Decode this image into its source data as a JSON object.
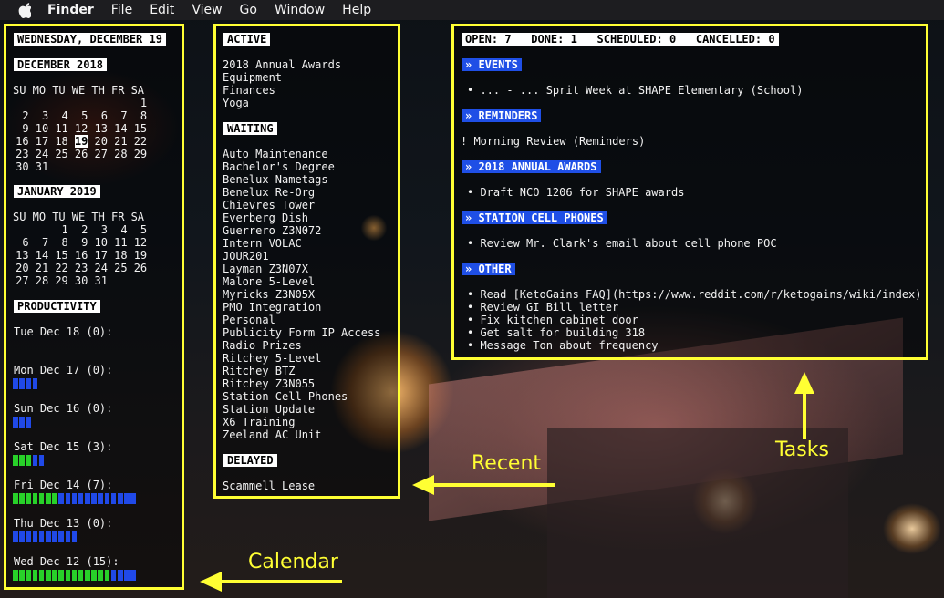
{
  "menubar": {
    "app": "Finder",
    "items": [
      "File",
      "Edit",
      "View",
      "Go",
      "Window",
      "Help"
    ]
  },
  "calendar": {
    "date_heading": "WEDNESDAY, DECEMBER 19",
    "months": [
      {
        "heading": "DECEMBER 2018",
        "weekdays": [
          "SU",
          "MO",
          "TU",
          "WE",
          "TH",
          "FR",
          "SA"
        ],
        "weeks": [
          [
            "",
            "",
            "",
            "",
            "",
            "",
            "1"
          ],
          [
            "2",
            "3",
            "4",
            "5",
            "6",
            "7",
            "8"
          ],
          [
            "9",
            "10",
            "11",
            "12",
            "13",
            "14",
            "15"
          ],
          [
            "16",
            "17",
            "18",
            "19",
            "20",
            "21",
            "22"
          ],
          [
            "23",
            "24",
            "25",
            "26",
            "27",
            "28",
            "29"
          ],
          [
            "30",
            "31",
            "",
            "",
            "",
            "",
            ""
          ]
        ],
        "today": "19"
      },
      {
        "heading": "JANUARY 2019",
        "weekdays": [
          "SU",
          "MO",
          "TU",
          "WE",
          "TH",
          "FR",
          "SA"
        ],
        "weeks": [
          [
            "",
            "",
            "1",
            "2",
            "3",
            "4",
            "5"
          ],
          [
            "6",
            "7",
            "8",
            "9",
            "10",
            "11",
            "12"
          ],
          [
            "13",
            "14",
            "15",
            "16",
            "17",
            "18",
            "19"
          ],
          [
            "20",
            "21",
            "22",
            "23",
            "24",
            "25",
            "26"
          ],
          [
            "27",
            "28",
            "29",
            "30",
            "31",
            "",
            ""
          ]
        ],
        "today": ""
      }
    ],
    "productivity": {
      "heading": "PRODUCTIVITY",
      "days": [
        {
          "label": "Tue Dec 18 (0):",
          "done": 0,
          "pending": 0
        },
        {
          "label": "Mon Dec 17 (0):",
          "done": 0,
          "pending": 4
        },
        {
          "label": "Sun Dec 16 (0):",
          "done": 0,
          "pending": 3
        },
        {
          "label": "Sat Dec 15 (3):",
          "done": 3,
          "pending": 2
        },
        {
          "label": "Fri Dec 14 (7):",
          "done": 7,
          "pending": 12
        },
        {
          "label": "Thu Dec 13 (0):",
          "done": 0,
          "pending": 10
        },
        {
          "label": "Wed Dec 12 (15):",
          "done": 15,
          "pending": 4
        }
      ]
    }
  },
  "recent": {
    "sections": [
      {
        "heading": "ACTIVE",
        "items": [
          "2018 Annual Awards",
          "Equipment",
          "Finances",
          "Yoga"
        ]
      },
      {
        "heading": "WAITING",
        "items": [
          "Auto Maintenance",
          "Bachelor's Degree",
          "Benelux Nametags",
          "Benelux Re-Org",
          "Chievres Tower",
          "Everberg Dish",
          "Guerrero Z3N072",
          "Intern VOLAC",
          "JOUR201",
          "Layman Z3N07X",
          "Malone 5-Level",
          "Myricks Z3N05X",
          "PMO Integration",
          "Personal",
          "Publicity Form IP Access",
          "Radio Prizes",
          "Ritchey 5-Level",
          "Ritchey BTZ",
          "Ritchey Z3N055",
          "Station Cell Phones",
          "Station Update",
          "X6 Training",
          "Zeeland AC Unit"
        ]
      },
      {
        "heading": "DELAYED",
        "items": [
          "Scammell Lease"
        ]
      }
    ]
  },
  "tasks": {
    "status": "OPEN: 7   DONE: 1   SCHEDULED: 0   CANCELLED: 0",
    "sections": [
      {
        "heading": "» EVENTS",
        "items": [
          "• ... - ... Sprit Week at SHAPE Elementary (School)"
        ],
        "indent": true
      },
      {
        "heading": "» REMINDERS",
        "items": [
          "! Morning Review (Reminders)"
        ],
        "indent": false
      },
      {
        "heading": "» 2018 ANNUAL AWARDS",
        "items": [
          "• Draft NCO 1206 for SHAPE awards"
        ],
        "indent": true
      },
      {
        "heading": "» STATION CELL PHONES",
        "items": [
          "• Review Mr. Clark's email about cell phone POC"
        ],
        "indent": true
      },
      {
        "heading": "» OTHER",
        "items": [
          "• Read [KetoGains FAQ](https://www.reddit.com/r/ketogains/wiki/index)",
          "• Review GI Bill letter",
          "• Fix kitchen cabinet door",
          "• Get salt for building 318",
          "• Message Ton about frequency"
        ],
        "indent": true
      }
    ]
  },
  "annotations": {
    "calendar": "Calendar",
    "recent": "Recent",
    "tasks": "Tasks"
  },
  "colors": {
    "highlight_border": "#ffff33",
    "done_bar": "#28d129",
    "pending_bar": "#2049e8",
    "section_heading": "#1f4fe6"
  }
}
